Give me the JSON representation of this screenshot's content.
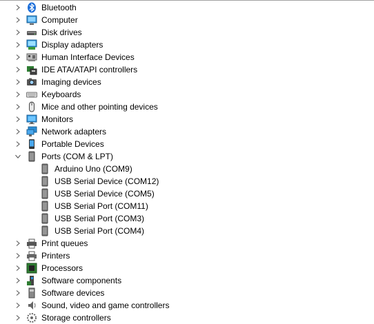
{
  "tree": {
    "categories_before": [
      {
        "label": "Bluetooth",
        "icon": "bluetooth-icon"
      },
      {
        "label": "Computer",
        "icon": "computer-icon"
      },
      {
        "label": "Disk drives",
        "icon": "disk-drive-icon"
      },
      {
        "label": "Display adapters",
        "icon": "display-adapter-icon"
      },
      {
        "label": "Human Interface Devices",
        "icon": "hid-icon"
      },
      {
        "label": "IDE ATA/ATAPI controllers",
        "icon": "ide-controller-icon"
      },
      {
        "label": "Imaging devices",
        "icon": "camera-icon"
      },
      {
        "label": "Keyboards",
        "icon": "keyboard-icon"
      },
      {
        "label": "Mice and other pointing devices",
        "icon": "mouse-icon"
      },
      {
        "label": "Monitors",
        "icon": "monitor-icon"
      },
      {
        "label": "Network adapters",
        "icon": "network-adapter-icon"
      },
      {
        "label": "Portable Devices",
        "icon": "portable-device-icon"
      }
    ],
    "expanded": {
      "label": "Ports (COM & LPT)",
      "icon": "port-icon",
      "children": [
        {
          "label": "Arduino Uno (COM9)"
        },
        {
          "label": "USB Serial Device (COM12)"
        },
        {
          "label": "USB Serial Device (COM5)"
        },
        {
          "label": "USB Serial Port (COM11)"
        },
        {
          "label": "USB Serial Port (COM3)"
        },
        {
          "label": "USB Serial Port (COM4)"
        }
      ]
    },
    "categories_after": [
      {
        "label": "Print queues",
        "icon": "print-queue-icon"
      },
      {
        "label": "Printers",
        "icon": "printer-icon"
      },
      {
        "label": "Processors",
        "icon": "processor-icon"
      },
      {
        "label": "Software components",
        "icon": "software-component-icon"
      },
      {
        "label": "Software devices",
        "icon": "software-device-icon"
      },
      {
        "label": "Sound, video and game controllers",
        "icon": "speaker-icon"
      },
      {
        "label": "Storage controllers",
        "icon": "storage-controller-icon"
      }
    ]
  },
  "colors": {
    "chevron": "#5a5a5a",
    "accent_blue": "#1e88e5"
  }
}
